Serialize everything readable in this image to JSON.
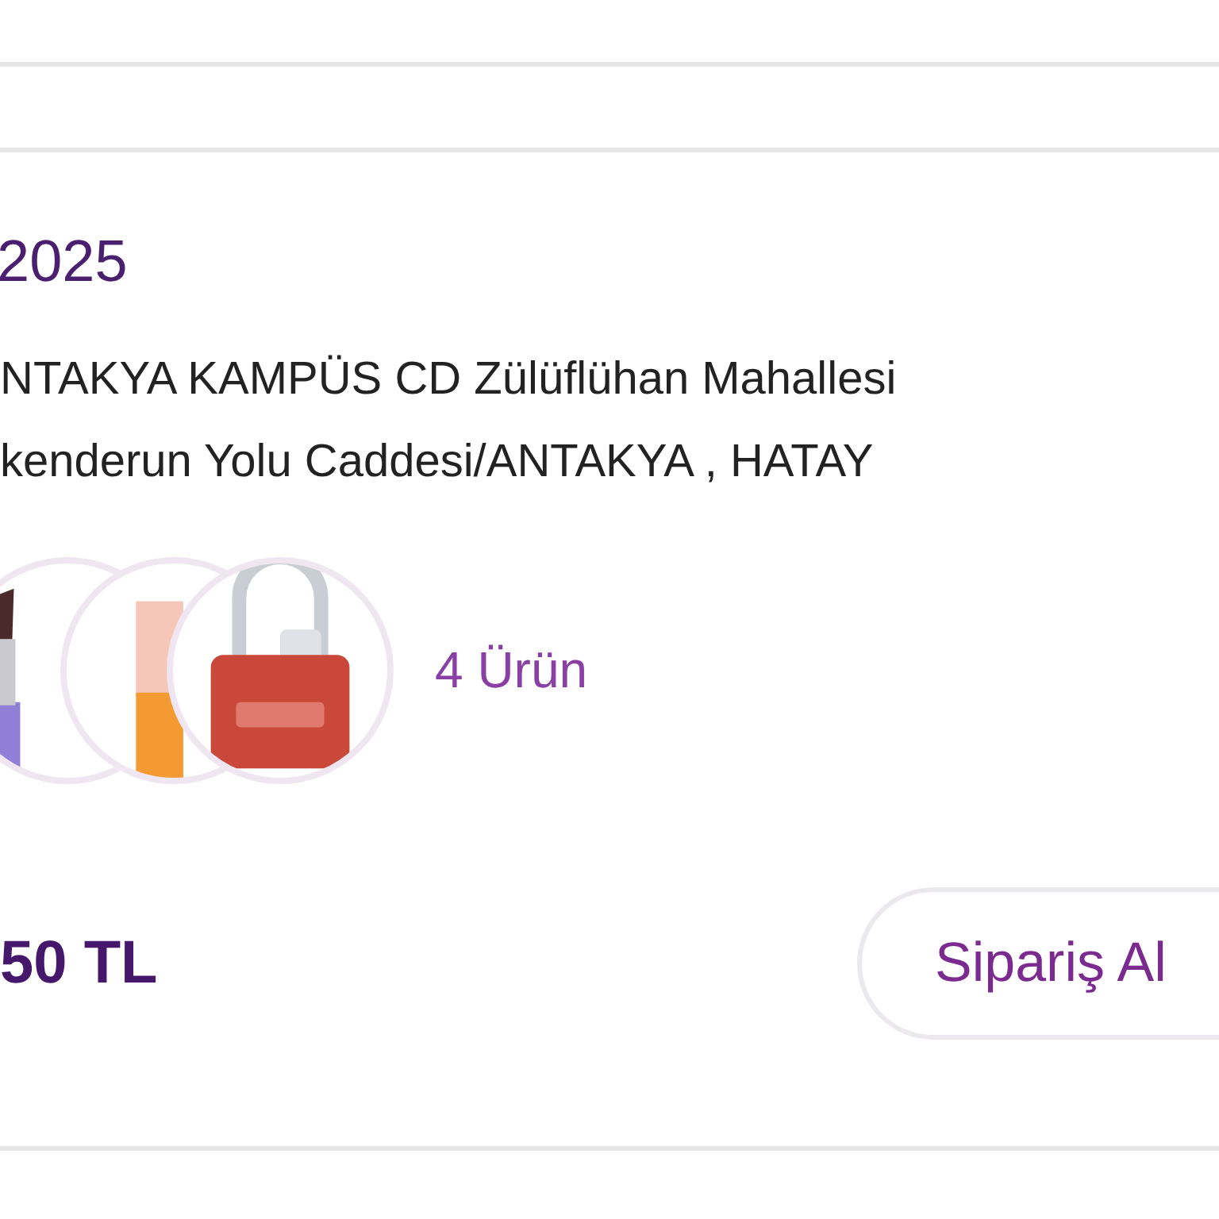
{
  "order": {
    "date": "2025",
    "address_lines": [
      "NTAKYA KAMPÜS CD Zülüflühan Mahallesi",
      "kenderun Yolu Caddesi/ANTAKYA , HATAY"
    ],
    "products": [
      {
        "kind": "picture"
      },
      {
        "kind": "picture"
      },
      {
        "kind": "picture"
      }
    ],
    "item_count": "4 Ürün",
    "total": "50 TL",
    "action_button": "Sipariş Al"
  }
}
